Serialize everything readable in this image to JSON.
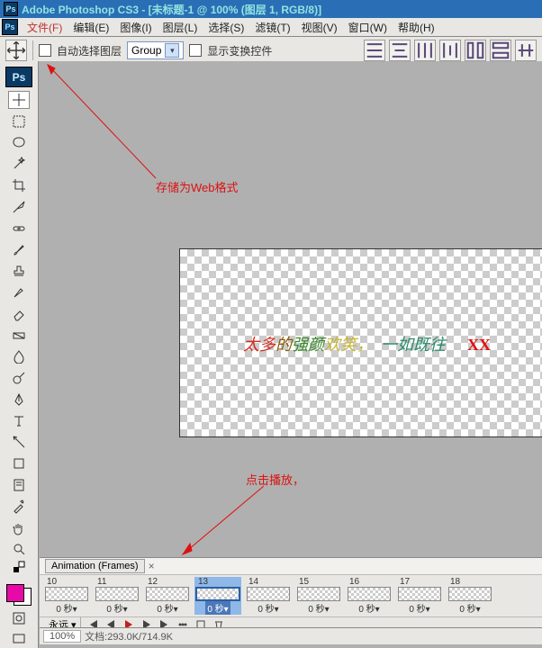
{
  "title": "Adobe Photoshop CS3 - [未标题-1 @ 100% (图层 1, RGB/8)]",
  "menu": [
    "文件(F)",
    "编辑(E)",
    "图像(I)",
    "图层(L)",
    "选择(S)",
    "滤镜(T)",
    "视图(V)",
    "窗口(W)",
    "帮助(H)"
  ],
  "menu_highlight_index": 0,
  "optbar": {
    "auto_select_label": "自动选择图层",
    "group_label": "Group",
    "show_transform_label": "显示变换控件"
  },
  "annotations": {
    "save_for_web": "存储为Web格式",
    "click_play": "点击播放，"
  },
  "canvas_text": {
    "a": "太多",
    "b": "的",
    "c": "强颜",
    "d": "欢笑，",
    "e": "一如既往",
    "x": "XX"
  },
  "animation": {
    "tab_label": "Animation (Frames)",
    "frames": [
      {
        "n": "10",
        "dur": "0 秒▾"
      },
      {
        "n": "11",
        "dur": "0 秒▾"
      },
      {
        "n": "12",
        "dur": "0 秒▾"
      },
      {
        "n": "13",
        "dur": "0 秒▾"
      },
      {
        "n": "14",
        "dur": "0 秒▾"
      },
      {
        "n": "15",
        "dur": "0 秒▾"
      },
      {
        "n": "16",
        "dur": "0 秒▾"
      },
      {
        "n": "17",
        "dur": "0 秒▾"
      },
      {
        "n": "18",
        "dur": "0 秒▾"
      }
    ],
    "selected_index": 3,
    "loop_label": "永远 ▾"
  },
  "status": {
    "zoom": "100%",
    "doc": "文档:293.0K/714.9K"
  },
  "colors": {
    "accent": "#2a6fb5",
    "annot": "#d11"
  }
}
